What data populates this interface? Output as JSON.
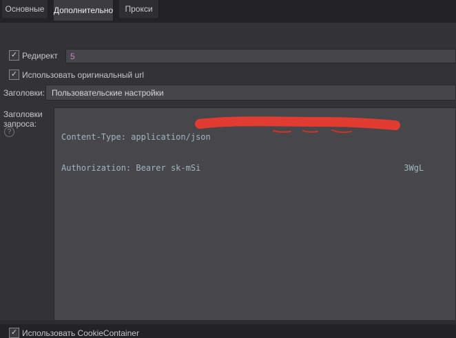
{
  "tabs": [
    {
      "label": "Основные"
    },
    {
      "label": "Дополнительно"
    },
    {
      "label": "Прокси"
    }
  ],
  "active_tab": "Дополнительно",
  "icons": {
    "check": "✓",
    "question": "?"
  },
  "redirect": {
    "label": "Редирект",
    "checked": true,
    "value": "5"
  },
  "use_original_url": {
    "label": "Использовать оригинальный url",
    "checked": true
  },
  "headers_preset": {
    "label": "Заголовки:",
    "selected": "Пользовательские настройки"
  },
  "request_headers": {
    "label": "Заголовки запроса:",
    "line1": "Content-Type: application/json",
    "line2_prefix": "Authorization: Bearer sk-mSi",
    "line2_suffix": "3WgL",
    "redacted": true
  },
  "use_cookie_container": {
    "label": "Использовать CookieContainer",
    "checked": true
  },
  "colors": {
    "redaction_red": "#e23b32",
    "number_value": "#c586c0",
    "mono_text": "#a0b7c1"
  }
}
